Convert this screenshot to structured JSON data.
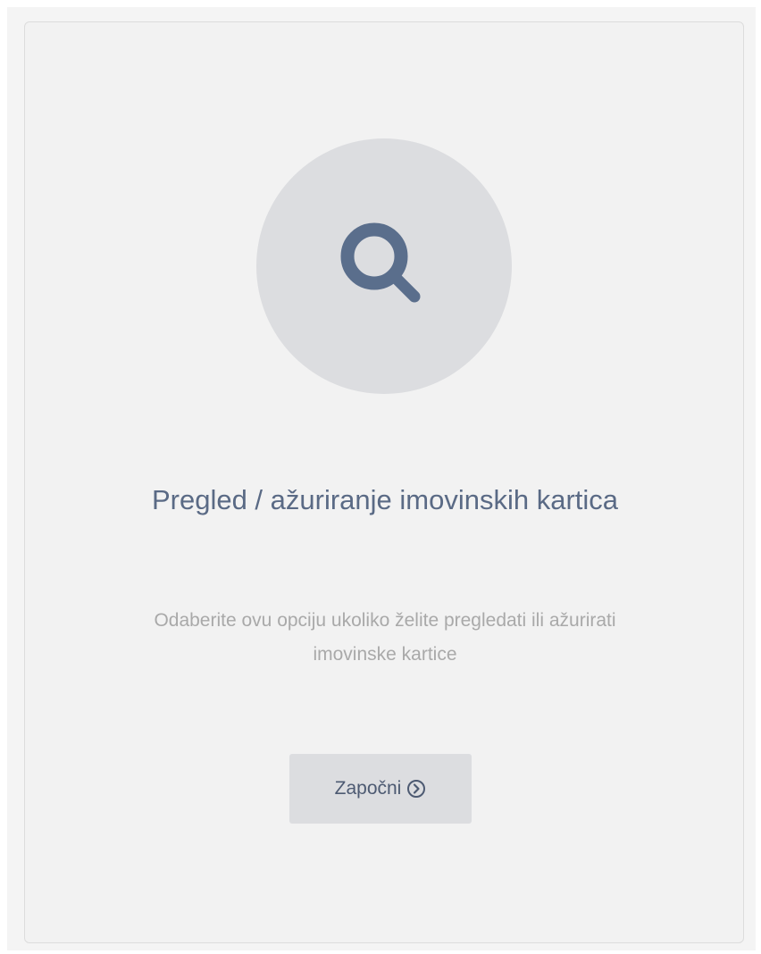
{
  "card": {
    "icon": "search-icon",
    "title": "Pregled / ažuriranje imovinskih kartica",
    "description": "Odaberite ovu opciju ukoliko želite pregledati ili ažurirati imovinske kartice",
    "button": {
      "label": "Započni",
      "icon": "chevron-circle-right-icon"
    }
  },
  "colors": {
    "background": "#f2f2f2",
    "icon_circle": "#dcdde0",
    "icon": "#5a6e8c",
    "title": "#5a6a85",
    "description": "#a9a9a9",
    "button_background": "#dcdde0",
    "button_text": "#4d5a72"
  }
}
